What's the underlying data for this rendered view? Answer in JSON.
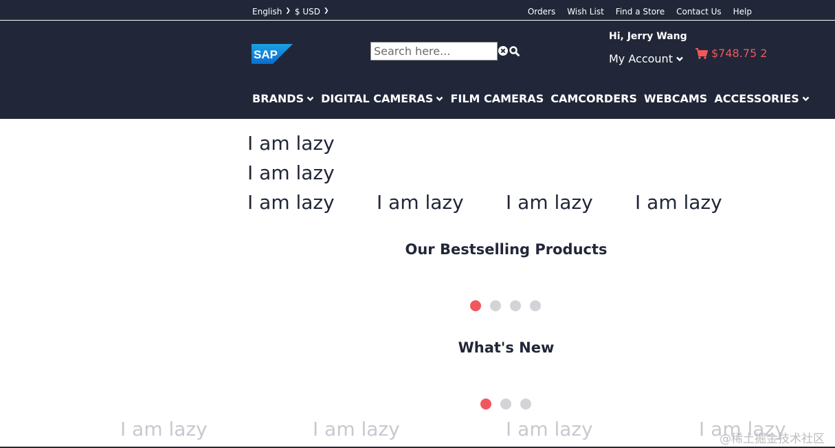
{
  "topbar": {
    "language": "English",
    "currency": "$ USD",
    "links": [
      "Orders",
      "Wish List",
      "Find a Store",
      "Contact Us",
      "Help"
    ]
  },
  "header": {
    "logo_text": "SAP",
    "search_placeholder": "Search here...",
    "greeting": "Hi, Jerry Wang",
    "account_label": "My Account",
    "cart_text": "$748.75 2"
  },
  "nav": {
    "items": [
      {
        "label": "BRANDS",
        "dropdown": true
      },
      {
        "label": "DIGITAL CAMERAS",
        "dropdown": true
      },
      {
        "label": "FILM CAMERAS",
        "dropdown": false
      },
      {
        "label": "CAMCORDERS",
        "dropdown": false
      },
      {
        "label": "WEBCAMS",
        "dropdown": false
      },
      {
        "label": "ACCESSORIES",
        "dropdown": true
      }
    ]
  },
  "main": {
    "lazy_text": "I am lazy",
    "bestselling_title": "Our Bestselling Products",
    "bestselling_slides": 4,
    "bestselling_active": 1,
    "whats_new_title": "What's New",
    "whats_new_slides": 3,
    "whats_new_active": 1
  },
  "watermark": "@稀土掘金技术社区",
  "colors": {
    "header_bg": "#212738",
    "accent": "#f0575d",
    "dot_inactive": "#d2d4d8",
    "faded_text": "#c7c9cf"
  }
}
